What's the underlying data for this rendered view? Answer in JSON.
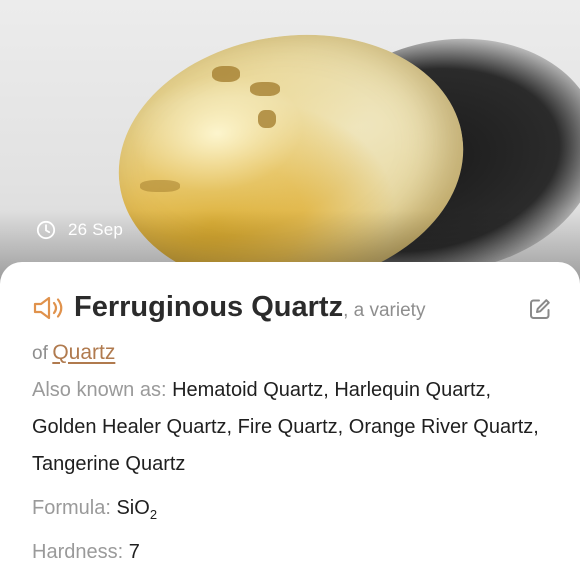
{
  "photo": {
    "date": "26 Sep",
    "icons": {
      "date": "clock-icon"
    }
  },
  "mineral": {
    "name": "Ferruginous Quartz",
    "variety_prefix": ", a variety",
    "variety_of_word": "of",
    "parent": "Quartz"
  },
  "details": {
    "aka_label": "Also known as:",
    "aka_value": "Hematoid Quartz, Harlequin Quartz, Golden Healer Quartz, Fire Quartz, Orange River Quartz, Tangerine Quartz",
    "formula_label": "Formula:",
    "formula_main": "SiO",
    "formula_sub": "2",
    "hardness_label": "Hardness:",
    "hardness_value": "7"
  },
  "icons": {
    "audio": "speaker-icon",
    "edit": "edit-icon"
  },
  "colors": {
    "accent": "#b07a4e",
    "speaker": "#e0924c",
    "label": "#9a9a9a",
    "text": "#1f1f1f"
  }
}
